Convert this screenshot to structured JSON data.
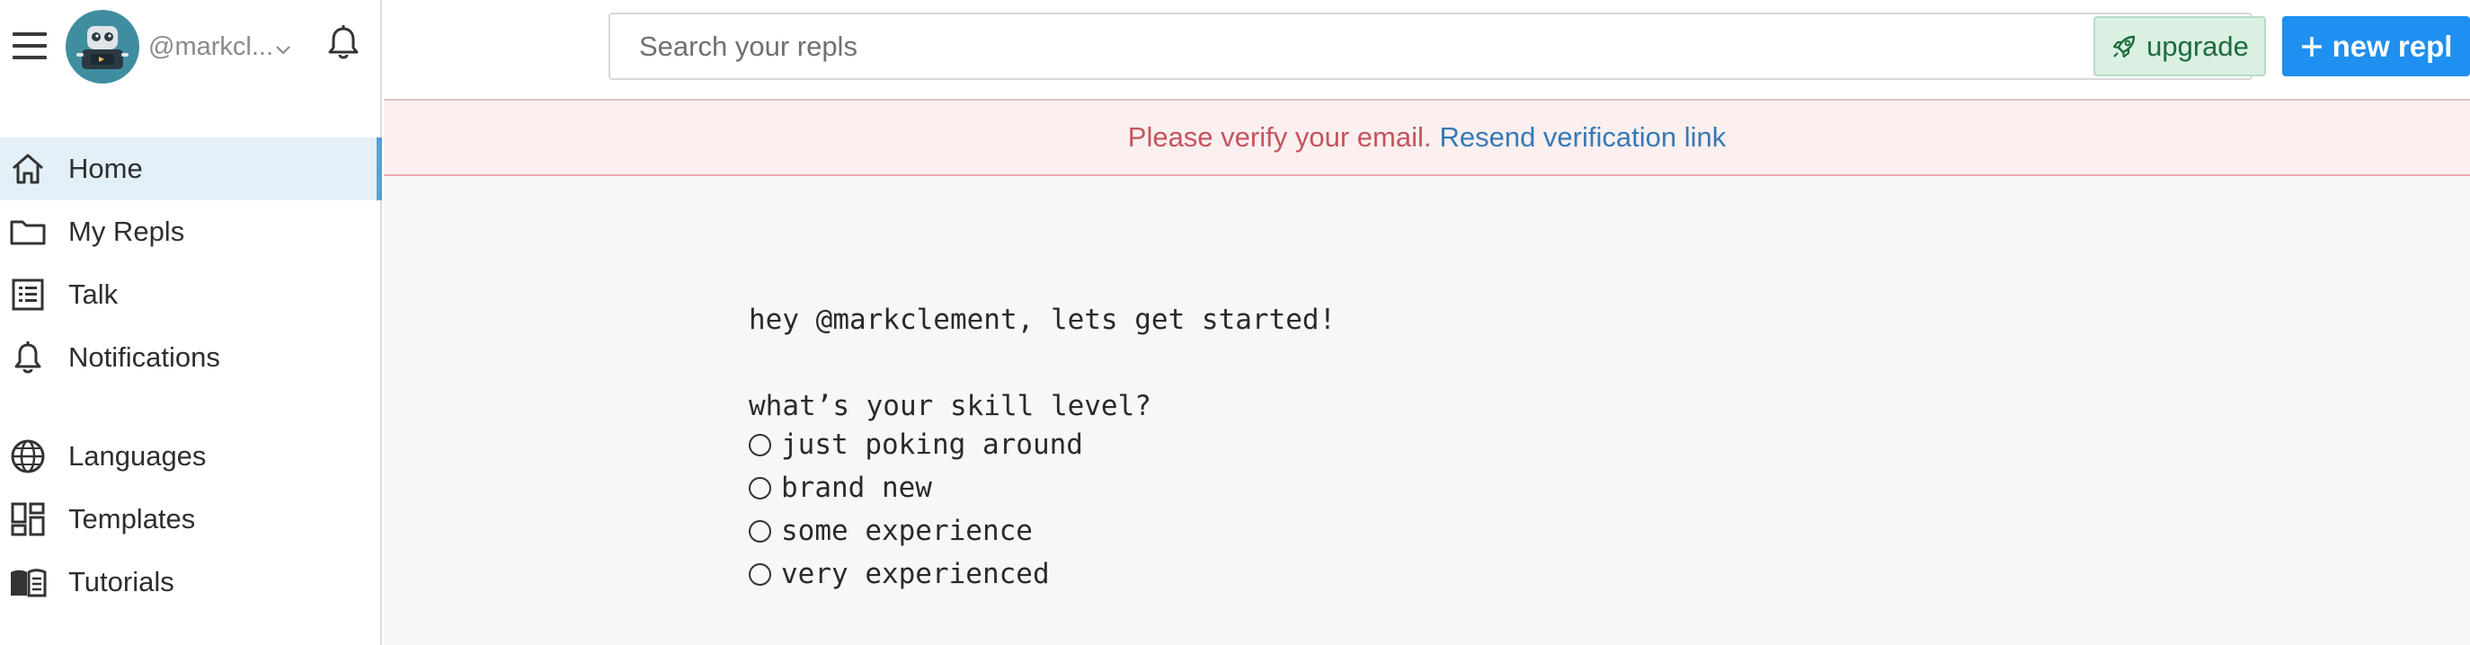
{
  "sidebar": {
    "username": "@markcl...",
    "items": [
      {
        "label": "Home",
        "icon": "home-icon",
        "active": true
      },
      {
        "label": "My Repls",
        "icon": "folder-icon"
      },
      {
        "label": "Talk",
        "icon": "list-icon"
      },
      {
        "label": "Notifications",
        "icon": "bell-icon"
      },
      {
        "label": "Languages",
        "icon": "globe-icon"
      },
      {
        "label": "Templates",
        "icon": "templates-icon"
      },
      {
        "label": "Tutorials",
        "icon": "book-icon"
      }
    ]
  },
  "topbar": {
    "search_placeholder": "Search your repls",
    "upgrade_label": "upgrade",
    "new_repl_label": "new repl"
  },
  "banner": {
    "message": "Please verify your email.",
    "link": "Resend verification link"
  },
  "onboarding": {
    "greeting": "hey @markclement, lets get started!",
    "question": "what’s your skill level?",
    "options": [
      "just poking around",
      "brand new",
      "some experience",
      "very experienced"
    ]
  },
  "colors": {
    "accent": "#1f8ff0",
    "active_nav_bg": "#e3f0f8",
    "active_nav_bar": "#4ea5d9",
    "banner_bg": "#fbeff0",
    "banner_text": "#c6545c",
    "link": "#3679b5",
    "upgrade_bg": "#d9f0e2",
    "upgrade_text": "#1f6b3d",
    "avatar_bg": "#3f8ea0"
  }
}
